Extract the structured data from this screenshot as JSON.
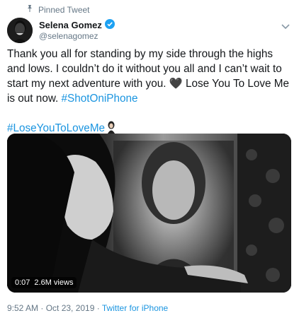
{
  "pinned_label": "Pinned Tweet",
  "user": {
    "name": "Selena Gomez",
    "handle": "@selenagomez"
  },
  "tweet": {
    "line1": "Thank you all for standing by my side through the highs and lows. I couldn’t do it without you all and I can’t wait to start my next adventure with you. ",
    "heart": "🖤",
    "line2": " Lose You To Love Me is out now. ",
    "hashtag1": "#ShotOniPhone",
    "hashtag2": "#LoseYouToLoveMe"
  },
  "video": {
    "time": "0:07",
    "views": "2.6M views"
  },
  "footer": {
    "timestamp": "9:52 AM · Oct 23, 2019 · ",
    "source": "Twitter for iPhone"
  },
  "colors": {
    "link": "#1b95e0",
    "verified": "#1da1f2",
    "meta": "#657786"
  },
  "icons": {
    "pin": "pin-icon",
    "verified": "verified-badge-icon",
    "more": "chevron-down-icon"
  }
}
